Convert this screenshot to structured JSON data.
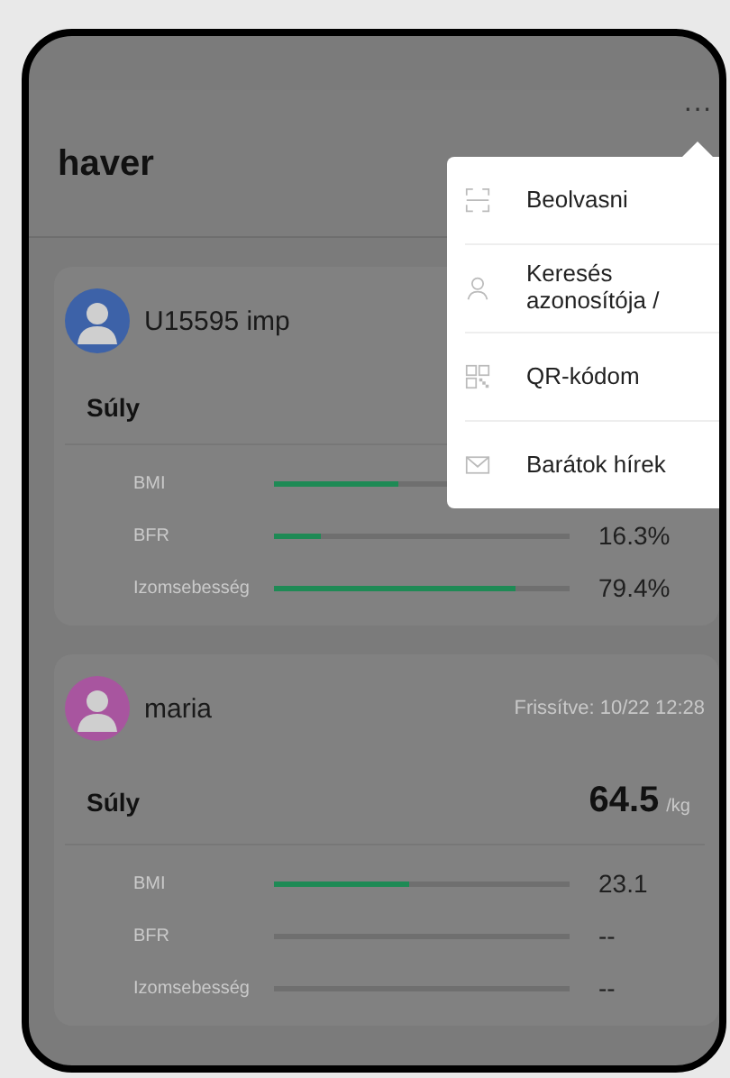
{
  "header": {
    "title": "haver",
    "more": "···"
  },
  "friends": [
    {
      "name": "U15595 imp",
      "color": "#3d62a8",
      "weight_label": "Súly",
      "metrics": [
        {
          "label": "BMI",
          "level": 0.42
        },
        {
          "label": "BFR",
          "level": 0.16,
          "reading": "16.3%"
        },
        {
          "label": "Izomsebesség",
          "level": 0.82,
          "reading": "79.4%"
        }
      ]
    },
    {
      "name": "maria",
      "color": "#a8559f",
      "updated": "Frissítve: 10/22 12:28",
      "weight_label": "Súly",
      "weight": "64.5",
      "unit": "/kg",
      "metrics": [
        {
          "label": "BMI",
          "level": 0.46,
          "reading": "23.1"
        },
        {
          "label": "BFR",
          "level": 0,
          "reading": "--"
        },
        {
          "label": "Izomsebesség",
          "level": 0,
          "reading": "--"
        }
      ]
    }
  ],
  "menu": [
    {
      "kind": "scan",
      "label": "Beolvasni"
    },
    {
      "kind": "person",
      "label": "Keresés azonosítója /"
    },
    {
      "kind": "qr",
      "label": "QR-kódom"
    },
    {
      "kind": "mail",
      "label": "Barátok hírek"
    }
  ]
}
